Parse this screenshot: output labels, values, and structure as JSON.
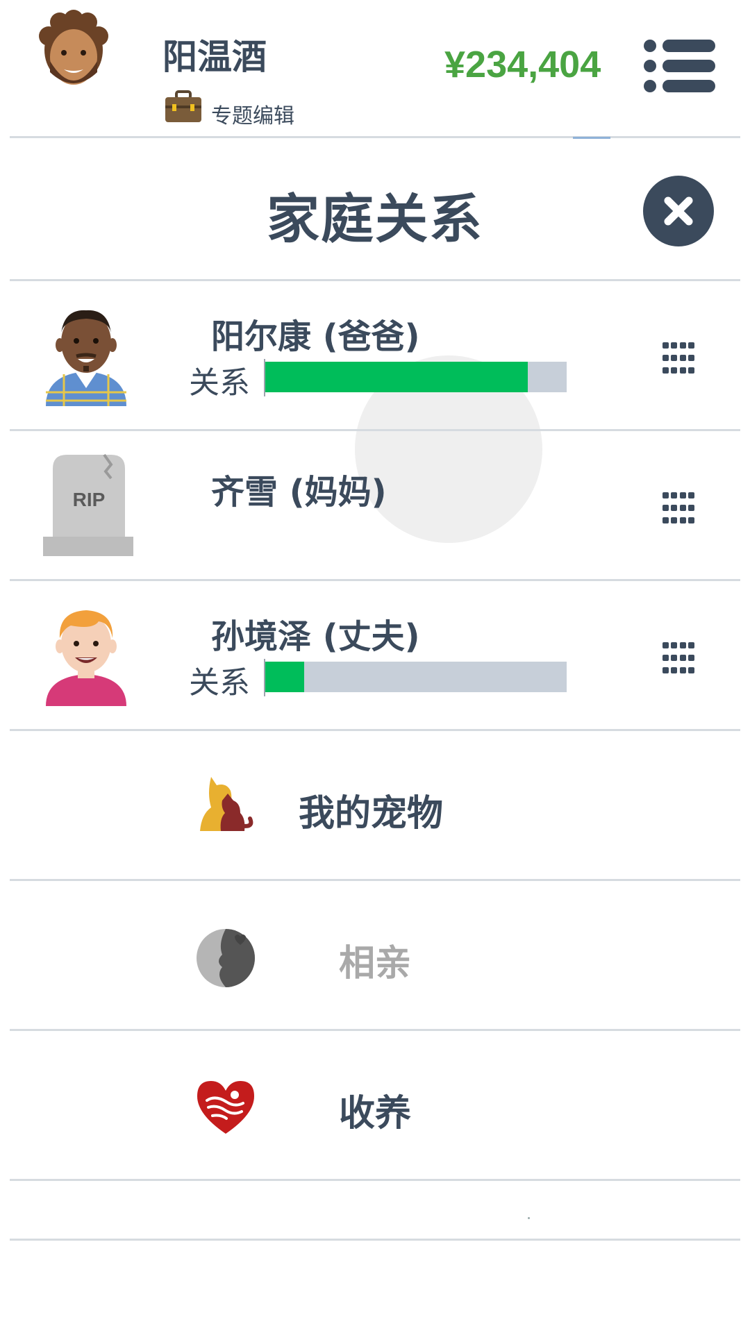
{
  "header": {
    "player_name": "阳温酒",
    "job_title": "专题编辑",
    "money": "¥234,404"
  },
  "panel": {
    "title": "家庭关系"
  },
  "relations": [
    {
      "name": "阳尔康 (爸爸)",
      "label": "关系",
      "relationship_level": 0.87,
      "status": "alive",
      "avatar": "dad-avatar"
    },
    {
      "name": "齐雪 (妈妈)",
      "status": "deceased",
      "avatar": "rip-tombstone-icon",
      "tombstone_text": "RIP"
    },
    {
      "name": "孙境泽 (丈夫)",
      "label": "关系",
      "relationship_level": 0.13,
      "status": "alive",
      "avatar": "husband-avatar"
    }
  ],
  "menu": [
    {
      "label": "我的宠物",
      "icon": "pets-icon",
      "enabled": true
    },
    {
      "label": "相亲",
      "icon": "blind-date-icon",
      "enabled": false
    },
    {
      "label": "收养",
      "icon": "adoption-heart-icon",
      "enabled": true
    }
  ],
  "colors": {
    "primary_text": "#3b4a5c",
    "money_green": "#4aa442",
    "bar_fill": "#00bd5a",
    "bar_bg": "#c7cfd9",
    "disabled_text": "#a9a9a9"
  }
}
